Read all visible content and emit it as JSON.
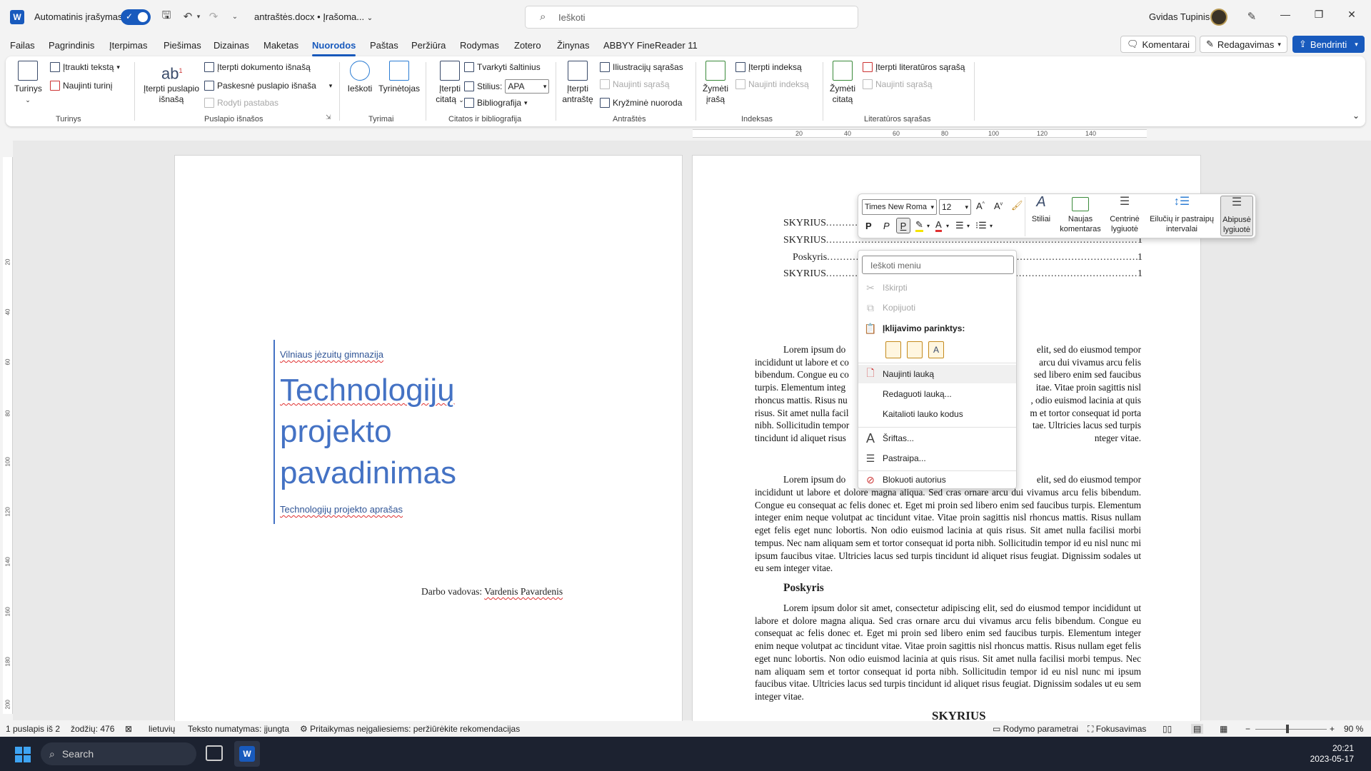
{
  "titlebar": {
    "autosave_label": "Automatinis įrašymas",
    "autosave_state": "on",
    "doc_title": "antraštės.docx • Įrašoma...",
    "search_placeholder": "Ieškoti",
    "user_name": "Gvidas Tupinis"
  },
  "menu": {
    "tabs": [
      "Failas",
      "Pagrindinis",
      "Įterpimas",
      "Piešimas",
      "Dizainas",
      "Maketas",
      "Nuorodos",
      "Paštas",
      "Peržiūra",
      "Rodymas",
      "Zotero",
      "Žinynas",
      "ABBYY FineReader 11"
    ],
    "active_tab": "Nuorodos",
    "comments_btn": "Komentarai",
    "editing_btn": "Redagavimas",
    "share_btn": "Bendrinti"
  },
  "ribbon": {
    "turinys": {
      "btn": "Turinys",
      "add_text": "Įtraukti tekstą",
      "update": "Naujinti turinį",
      "group": "Turinys"
    },
    "footnotes": {
      "insert": "Įterpti puslapio išnašą",
      "insert_endnote": "Įterpti dokumento išnašą",
      "next": "Paskesnė puslapio išnaša",
      "show": "Rodyti pastabas",
      "group": "Puslapio išnašos"
    },
    "research": {
      "search": "Ieškoti",
      "researcher": "Tyrinėtojas",
      "group": "Tyrimai"
    },
    "citations": {
      "insert": "Įterpti citatą",
      "manage": "Tvarkyti šaltinius",
      "style_label": "Stilius:",
      "style_value": "APA",
      "bibliography": "Bibliografija",
      "group": "Citatos ir bibliografija"
    },
    "captions": {
      "insert": "Įterpti antraštę",
      "table_of_figures": "Iliustracijų sąrašas",
      "update": "Naujinti sąrašą",
      "crossref": "Kryžminė nuoroda",
      "group": "Antraštės"
    },
    "index": {
      "mark": "Žymėti įrašą",
      "insert": "Įterpti indeksą",
      "update": "Naujinti indeksą",
      "group": "Indeksas"
    },
    "authorities": {
      "mark": "Žymėti citatą",
      "insert": "Įterpti literatūros sąrašą",
      "update": "Naujinti sąrašą",
      "group": "Literatūros sąrašas"
    }
  },
  "page1": {
    "school": "Vilniaus jėzuitų gimnazija",
    "title_lines": [
      "Technologijų",
      "projekto",
      "pavadinimas"
    ],
    "subtitle": "Technologijų projekto aprašas",
    "supervisor_label": "Darbo vadovas:",
    "supervisor_name": "Vardenis Pavardenis"
  },
  "page2": {
    "toc": [
      {
        "label": "SKYRIUS",
        "page": "1"
      },
      {
        "label": "SKYRIUS",
        "page": "1"
      },
      {
        "label": "Poskyris",
        "page": "1"
      },
      {
        "label": "SKYRIUS",
        "page": "1"
      }
    ],
    "para_full": "Lorem ipsum dolor sit amet, consectetur adipiscing elit, sed do eiusmod tempor incididunt ut labore et dolore magna aliqua. Sed cras ornare arcu dui vivamus arcu felis bibendum. Congue eu consequat ac felis donec et. Eget mi proin sed libero enim sed faucibus turpis. Elementum integer enim neque volutpat ac tincidunt vitae. Vitae proin sagittis nisl rhoncus mattis. Risus nullam eget felis eget nunc lobortis. Non odio euismod lacinia at quis risus. Sit amet nulla facilisi morbi tempus. Nec nam aliquam sem et tortor consequat id porta nibh. Sollicitudin tempor id eu nisl nunc mi ipsum faucibus vitae. Ultricies lacus sed turpis tincidunt id aliquet risus feugiat. Dignissim sodales ut eu sem integer vitae.",
    "para1_left": [
      "Lorem ipsum do",
      "incididunt ut labore et co",
      "bibendum. Congue eu co",
      "turpis. Elementum integ",
      "rhoncus mattis. Risus nu",
      "risus. Sit amet nulla facil",
      "nibh. Sollicitudin tempor",
      "tincidunt id aliquet risus"
    ],
    "para1_right": [
      "elit, sed do eiusmod tempor",
      "arcu dui vivamus arcu felis",
      "sed libero enim sed faucibus",
      "itae. Vitae proin sagittis nisl",
      ", odio euismod lacinia at quis",
      "m et tortor consequat id porta",
      "tae. Ultricies lacus sed turpis",
      "nteger vitae."
    ],
    "para2_left": "Lorem ipsum do",
    "para2_right": "elit, sed do eiusmod tempor",
    "para2_rest": "incididunt ut labore et dolore magna aliqua. Sed cras ornare arcu dui vivamus arcu felis bibendum. Congue eu consequat ac felis donec et. Eget mi proin sed libero enim sed faucibus turpis. Elementum integer enim neque volutpat ac tincidunt vitae. Vitae proin sagittis nisl rhoncus mattis. Risus nullam eget felis eget nunc lobortis. Non odio euismod lacinia at quis risus. Sit amet nulla facilisi morbi tempus. Nec nam aliquam sem et tortor consequat id porta nibh. Sollicitudin tempor id eu nisl nunc mi ipsum faucibus vitae. Ultricies lacus sed turpis tincidunt id aliquet risus feugiat. Dignissim sodales ut eu sem integer vitae.",
    "poskyris_heading": "Poskyris",
    "skyrius_heading": "SKYRIUS"
  },
  "minibar": {
    "font": "Times New Roma",
    "size": "12",
    "bold": "P",
    "italic": "P",
    "underline": "P",
    "styles": "Stiliai",
    "new_comment": [
      "Naujas",
      "komentaras"
    ],
    "center": [
      "Centrinė",
      "lygiuotė"
    ],
    "spacing": [
      "Eilučių ir pastraipų",
      "intervalai"
    ],
    "justify": [
      "Abipusė",
      "lygiuotė"
    ]
  },
  "context_menu": {
    "search_placeholder": "Ieškoti meniu",
    "cut": "Iškirpti",
    "copy": "Kopijuoti",
    "paste_options": "Įklijavimo parinktys:",
    "update_field": "Naujinti lauką",
    "edit_field": "Redaguoti lauką...",
    "toggle_codes": "Kaitalioti lauko kodus",
    "font": "Šriftas...",
    "paragraph": "Pastraipa...",
    "block_authors": "Blokuoti autorius"
  },
  "status": {
    "page": "1 puslapis iš 2",
    "words": "žodžių: 476",
    "language": "lietuvių",
    "predictions": "Teksto numatymas: įjungta",
    "accessibility": "Pritaikymas neįgaliesiems: peržiūrėkite rekomendacijas",
    "display_settings": "Rodymo parametrai",
    "focus": "Fokusavimas",
    "zoom": "90 %"
  },
  "taskbar": {
    "search": "Search",
    "time": "20:21",
    "date": "2023-05-17"
  },
  "ruler": {
    "h_labels": [
      "20",
      "40",
      "60",
      "80",
      "100",
      "120",
      "140"
    ],
    "v_labels": [
      "20",
      "40",
      "60",
      "80",
      "100",
      "120",
      "140",
      "160",
      "180",
      "200"
    ]
  },
  "colors": {
    "accent": "#185abd",
    "cover_blue": "#4472c4",
    "spell_error": "#e03030"
  }
}
